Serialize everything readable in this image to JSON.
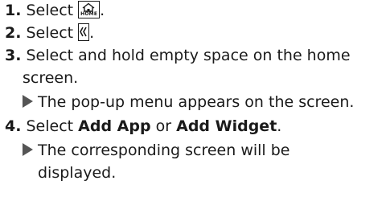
{
  "steps": [
    {
      "number": "1.",
      "text_before": "Select ",
      "icon": "home-icon",
      "icon_label": "HOME",
      "text_after": "."
    },
    {
      "number": "2.",
      "text_before": "Select ",
      "icon": "double-chevron-left-icon",
      "text_after": "."
    },
    {
      "number": "3.",
      "line1": "Select and hold empty space on the home",
      "line2": "screen.",
      "result": "The pop-up menu appears on the screen."
    },
    {
      "number": "4.",
      "text_before": "Select ",
      "bold1": "Add App",
      "middle": " or ",
      "bold2": "Add Widget",
      "text_after": ".",
      "result_line1": "The corresponding screen will be",
      "result_line2": "displayed."
    }
  ],
  "colors": {
    "text": "#1a1a1a",
    "result_arrow": "#555555"
  }
}
